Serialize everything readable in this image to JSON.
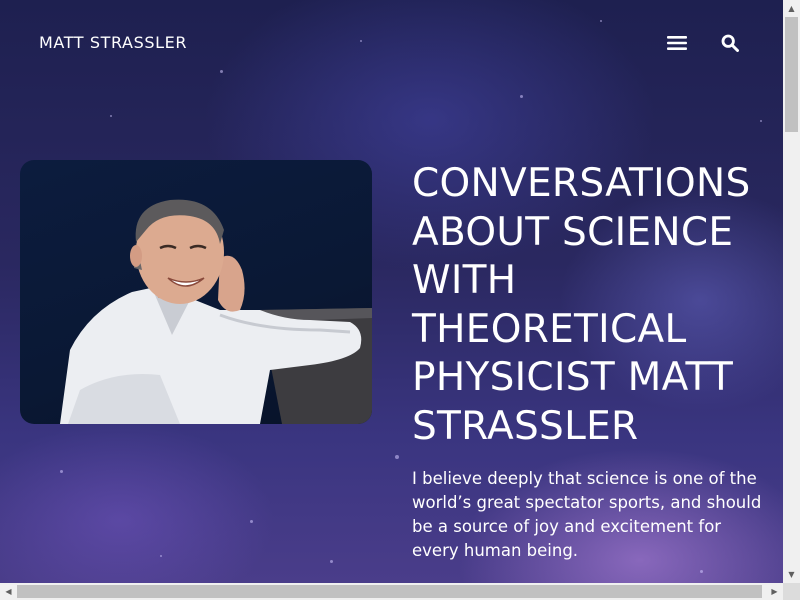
{
  "header": {
    "site_title": "MATT STRASSLER",
    "menu_icon": "hamburger-menu-icon",
    "search_icon": "search-icon"
  },
  "hero": {
    "portrait_alt": "Portrait of Matt Strassler",
    "headline": "CONVERSATIONS ABOUT SCIENCE WITH THEORETICAL PHYSICIST MATT STRASSLER",
    "intro": "I believe deeply that science is one of the world’s great spectator sports, and should be a source of joy and excitement for every human being."
  },
  "colors": {
    "background": "#2a2860",
    "text": "#ffffff",
    "scrollbar_track": "#f0f0f0",
    "scrollbar_thumb": "#c1c1c1"
  },
  "scrollbars": {
    "up_arrow": "▲",
    "down_arrow": "▼",
    "left_arrow": "◀",
    "right_arrow": "▶"
  }
}
